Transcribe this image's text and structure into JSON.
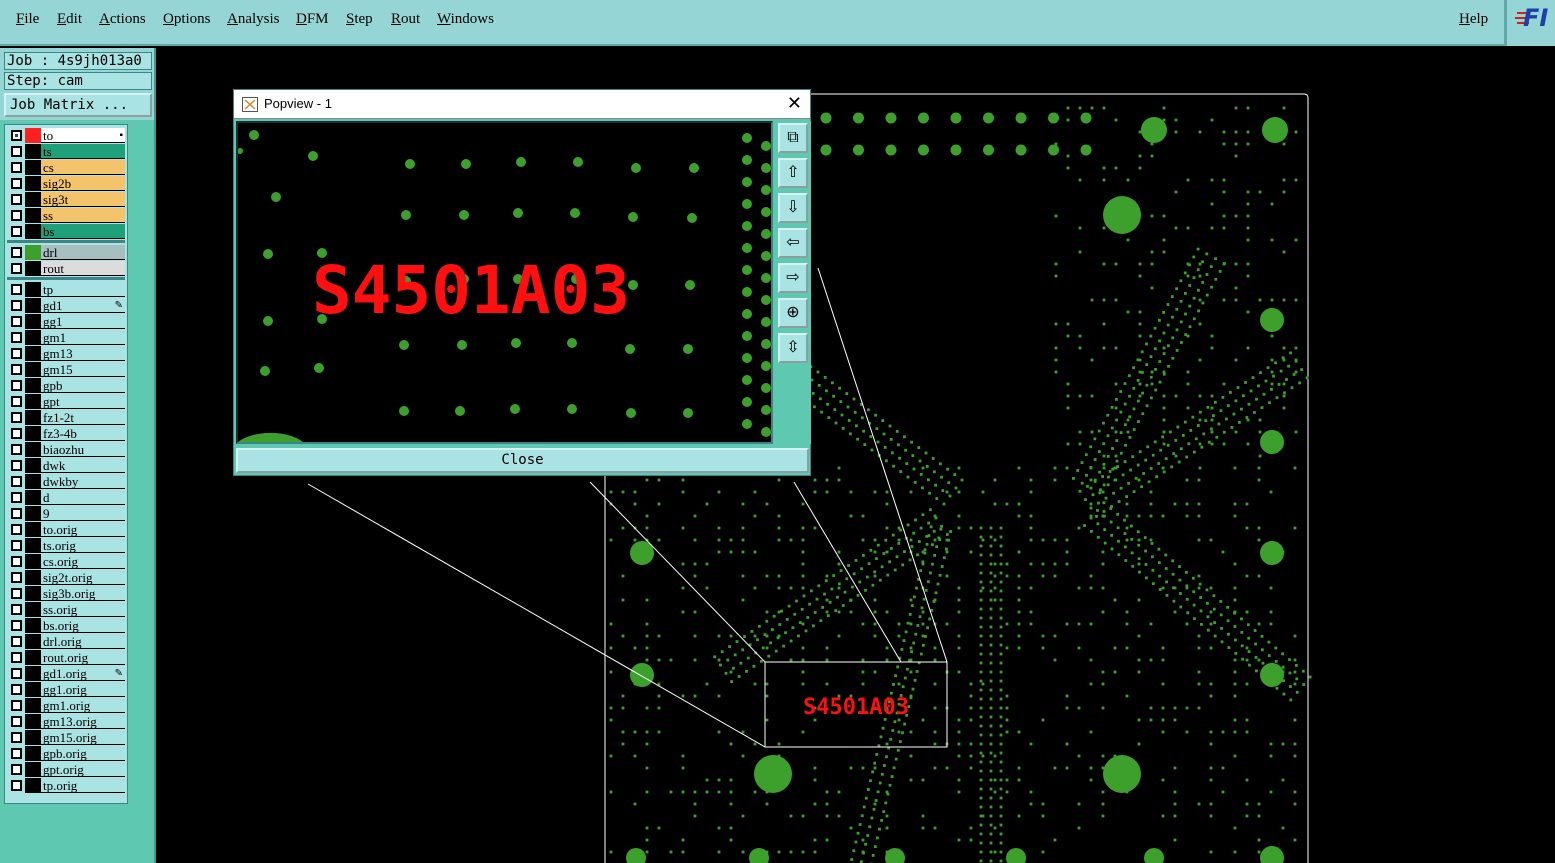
{
  "menubar": {
    "items": [
      "File",
      "Edit",
      "Actions",
      "Options",
      "Analysis",
      "DFM",
      "Step",
      "Rout",
      "Windows"
    ],
    "help": "Help",
    "logo_text": "FI",
    "logo_color": "#1d3fa8"
  },
  "info": {
    "job": "Job : 4s9jh013a0",
    "step": "Step: cam",
    "job_matrix": "Job Matrix ..."
  },
  "layers": {
    "board_layers": [
      {
        "name": "to",
        "color": "#ffffff",
        "swatch": "#ff2020",
        "active": true
      },
      {
        "name": "ts",
        "color": "#1fa07a"
      },
      {
        "name": "cs",
        "color": "#f3c46b"
      },
      {
        "name": "sig2b",
        "color": "#f3c46b"
      },
      {
        "name": "sig3t",
        "color": "#f3c46b"
      },
      {
        "name": "ss",
        "color": "#f3c46b"
      },
      {
        "name": "bs",
        "color": "#1fa07a"
      }
    ],
    "drill_layers": [
      {
        "name": "drl",
        "color": "#a8bfbf",
        "swatch": "#3ea02c"
      },
      {
        "name": "rout",
        "color": "#dcdcdc"
      }
    ],
    "misc_layers": [
      {
        "name": "tp"
      },
      {
        "name": "gd1",
        "edit": true
      },
      {
        "name": "gg1"
      },
      {
        "name": "gm1"
      },
      {
        "name": "gm13"
      },
      {
        "name": "gm15"
      },
      {
        "name": "gpb"
      },
      {
        "name": "gpt"
      },
      {
        "name": "fz1-2t"
      },
      {
        "name": "fz3-4b"
      },
      {
        "name": "biaozhu"
      },
      {
        "name": "dwk"
      },
      {
        "name": "dwkby"
      },
      {
        "name": "d"
      },
      {
        "name": "9"
      },
      {
        "name": "to.orig"
      },
      {
        "name": "ts.orig"
      },
      {
        "name": "cs.orig"
      },
      {
        "name": "sig2t.orig"
      },
      {
        "name": "sig3b.orig"
      },
      {
        "name": "ss.orig"
      },
      {
        "name": "bs.orig"
      },
      {
        "name": "drl.orig"
      },
      {
        "name": "rout.orig"
      },
      {
        "name": "gd1.orig",
        "edit": true
      },
      {
        "name": "gg1.orig"
      },
      {
        "name": "gm1.orig"
      },
      {
        "name": "gm13.orig"
      },
      {
        "name": "gm15.orig"
      },
      {
        "name": "gpb.orig"
      },
      {
        "name": "gpt.orig"
      },
      {
        "name": "tp.orig"
      }
    ],
    "misc_color": "#a9e3e3"
  },
  "board": {
    "label_text": "S4501A03",
    "label_color": "#ff1010",
    "pad_color": "#3ea02c"
  },
  "popview": {
    "title": "Popview - 1",
    "close_label": "Close",
    "label_text": "S4501A03",
    "tools": [
      "zoom-fit-icon",
      "layer-up-icon",
      "layer-down-icon",
      "pan-left-icon",
      "pan-right-icon",
      "zoom-in-icon",
      "zoom-out-icon"
    ]
  }
}
